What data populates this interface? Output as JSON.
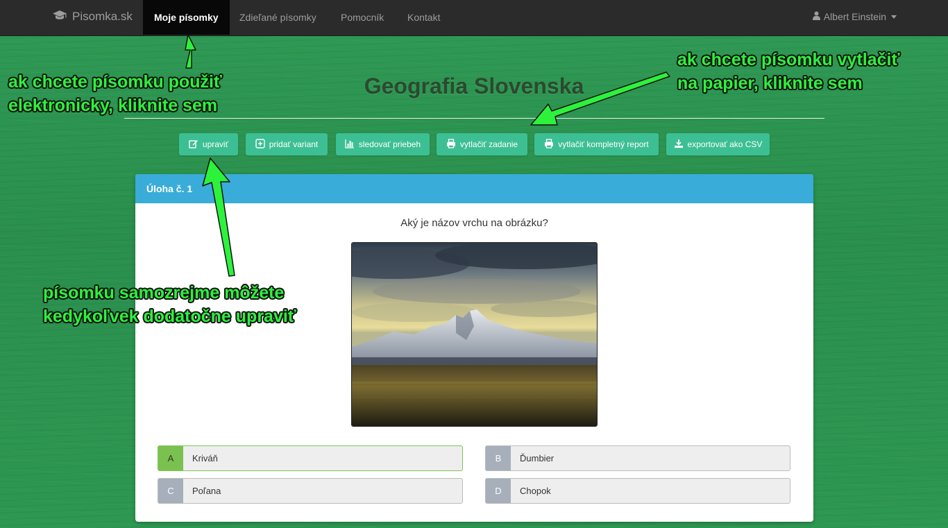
{
  "nav": {
    "brand": "Pisomka.sk",
    "items": [
      {
        "label": "Moje písomky",
        "active": true
      },
      {
        "label": "Zdieľané písomky"
      },
      {
        "label": "Pomocník"
      },
      {
        "label": "Kontakt"
      }
    ],
    "user": "Albert Einstein"
  },
  "page_title": "Geografia Slovenska",
  "toolbar": {
    "edit": "upraviť",
    "add_variant": "pridať variant",
    "track": "sledovať priebeh",
    "print_task": "vytlačiť zadanie",
    "print_report": "vytlačiť kompletný report",
    "export_csv": "exportovať ako CSV"
  },
  "task": {
    "header": "Úloha č. 1",
    "question": "Aký je názov vrchu na obrázku?",
    "answers": [
      {
        "letter": "A",
        "text": "Kriváň",
        "correct": true
      },
      {
        "letter": "B",
        "text": "Ďumbier"
      },
      {
        "letter": "C",
        "text": "Poľana"
      },
      {
        "letter": "D",
        "text": "Chopok"
      }
    ]
  },
  "annotations": {
    "electronic": [
      "ak chcete písomku použiť",
      "elektronicky, kliknite sem"
    ],
    "print": [
      "ak chcete písomku vytlačiť",
      "na papier, kliknite sem"
    ],
    "edit": [
      "písomku samozrejme môžete",
      "kedykoľvek dodatočne upraviť"
    ]
  },
  "colors": {
    "background_green": "#2d9852",
    "navbar": "#2b2b2b",
    "toolbar_button": "#3dbf94",
    "card_header": "#3aacd9",
    "correct_answer": "#7bc14f",
    "annotation_text": "#2cf23c"
  }
}
